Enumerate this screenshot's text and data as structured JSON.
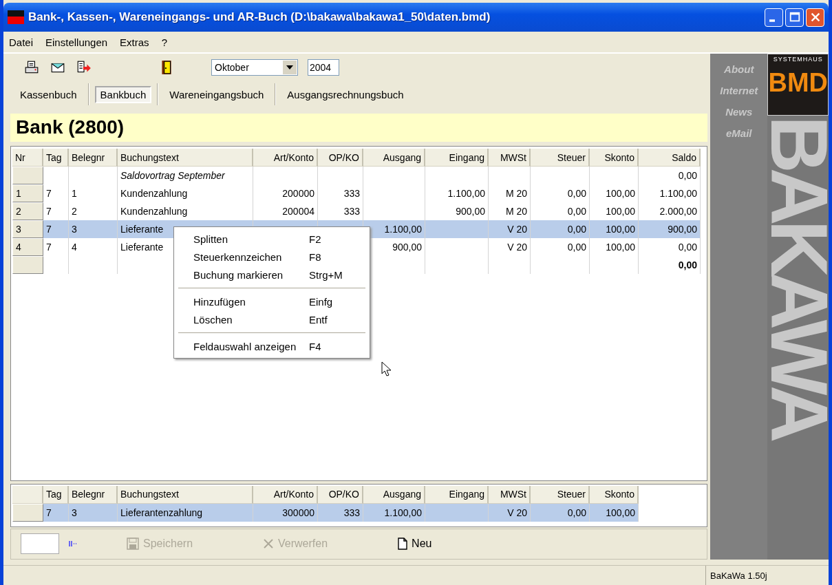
{
  "window": {
    "title": "Bank-, Kassen-, Wareneingangs- und AR-Buch (D:\\bakawa\\bakawa1_50\\daten.bmd)"
  },
  "menu": [
    "Datei",
    "Einstellungen",
    "Extras",
    "?"
  ],
  "period": {
    "month": "Oktober",
    "year": "2004"
  },
  "tabs": [
    {
      "label": "Kassenbuch",
      "selected": false
    },
    {
      "label": "Bankbuch",
      "selected": true
    },
    {
      "label": "Wareneingangsbuch",
      "selected": false
    },
    {
      "label": "Ausgangsrechnungsbuch",
      "selected": false
    }
  ],
  "heading": "Bank (2800)",
  "table": {
    "columns": [
      "Nr",
      "Tag",
      "Belegnr",
      "Buchungstext",
      "Art/Konto",
      "OP/KO",
      "Ausgang",
      "Eingang",
      "MWSt",
      "Steuer",
      "Skonto",
      "Saldo"
    ],
    "rows": [
      {
        "kind": "carryover",
        "selected": false,
        "Buchungstext": "Saldovortrag September",
        "Saldo": "0,00"
      },
      {
        "kind": "entry",
        "selected": false,
        "Nr": "1",
        "Tag": "7",
        "Belegnr": "1",
        "Buchungstext": "Kundenzahlung",
        "Art/Konto": "200000",
        "OP/KO": "333",
        "Eingang": "1.100,00",
        "MWSt": "M 20",
        "Steuer": "0,00",
        "Skonto": "100,00",
        "Saldo": "1.100,00"
      },
      {
        "kind": "entry",
        "selected": false,
        "Nr": "2",
        "Tag": "7",
        "Belegnr": "2",
        "Buchungstext": "Kundenzahlung",
        "Art/Konto": "200004",
        "OP/KO": "333",
        "Eingang": "900,00",
        "MWSt": "M 20",
        "Steuer": "0,00",
        "Skonto": "100,00",
        "Saldo": "2.000,00"
      },
      {
        "kind": "entry",
        "selected": true,
        "Nr": "3",
        "Tag": "7",
        "Belegnr": "3",
        "Buchungstext": "Lieferante",
        "Ausgang": "1.100,00",
        "MWSt": "V 20",
        "Steuer": "0,00",
        "Skonto": "100,00",
        "Saldo": "900,00"
      },
      {
        "kind": "entry",
        "selected": false,
        "Nr": "4",
        "Tag": "7",
        "Belegnr": "4",
        "Buchungstext": "Lieferante",
        "Ausgang": "900,00",
        "MWSt": "V 20",
        "Steuer": "0,00",
        "Skonto": "100,00",
        "Saldo": "0,00"
      },
      {
        "kind": "total",
        "selected": false,
        "Saldo": "0,00"
      }
    ]
  },
  "context_menu": [
    {
      "kind": "item",
      "label": "Splitten",
      "shortcut": "F2"
    },
    {
      "kind": "item",
      "label": "Steuerkennzeichen",
      "shortcut": "F8"
    },
    {
      "kind": "item",
      "label": "Buchung markieren",
      "shortcut": "Strg+M"
    },
    {
      "kind": "separator"
    },
    {
      "kind": "item",
      "label": "Hinzufügen",
      "shortcut": "Einfg"
    },
    {
      "kind": "item",
      "label": "Löschen",
      "shortcut": "Entf"
    },
    {
      "kind": "separator"
    },
    {
      "kind": "item",
      "label": "Feldauswahl anzeigen",
      "shortcut": "F4"
    }
  ],
  "split_table": {
    "columns": [
      "Tag",
      "Belegnr",
      "Buchungstext",
      "Art/Konto",
      "OP/KO",
      "Ausgang",
      "Eingang",
      "MWSt",
      "Steuer",
      "Skonto"
    ],
    "rows": [
      {
        "selected": true,
        "Tag": "7",
        "Belegnr": "3",
        "Buchungstext": "Lieferantenzahlung",
        "Art/Konto": "300000",
        "OP/KO": "333",
        "Ausgang": "1.100,00",
        "MWSt": "V 20",
        "Steuer": "0,00",
        "Skonto": "100,00"
      }
    ]
  },
  "actions": [
    {
      "label": "Speichern",
      "disabled": true
    },
    {
      "label": "Verwerfen",
      "disabled": true
    },
    {
      "label": "Neu",
      "disabled": false
    }
  ],
  "sidebar": {
    "links": [
      "About",
      "Internet",
      "News",
      "eMail"
    ],
    "logo_tagline": "SYSTEMHAUS",
    "logo_mark": "BMD",
    "banner": "BAKAWA"
  },
  "status_bar": {
    "version": "BaKaWa 1.50j"
  }
}
